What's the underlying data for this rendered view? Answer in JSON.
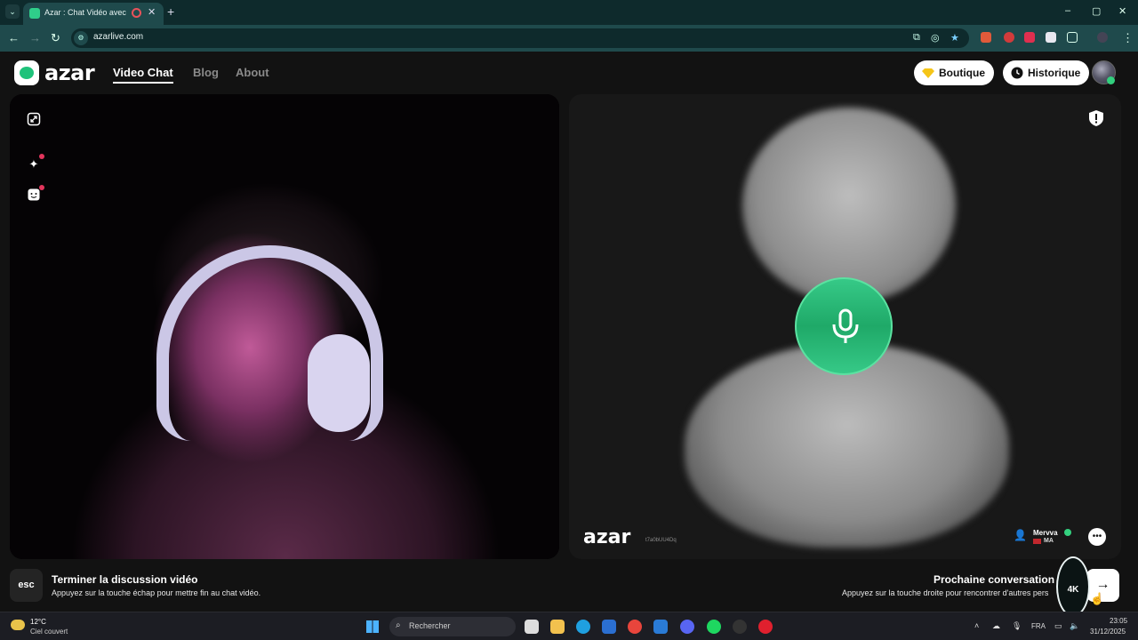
{
  "browser": {
    "tab_title": "Azar : Chat Vidéo avec de n",
    "new_tab": "+",
    "url": "azarlive.com",
    "window_controls": [
      "–",
      "▢",
      "✕"
    ]
  },
  "header": {
    "brand": "azar",
    "nav": [
      "Video Chat",
      "Blog",
      "About"
    ],
    "active_nav": "Video Chat",
    "boutique_label": "Boutique",
    "historique_label": "Historique"
  },
  "partner": {
    "watermark": "azar",
    "session_id": "t7a0bUU4Dq",
    "name": "Mervva",
    "country": "MA"
  },
  "bottom": {
    "esc_key": "esc",
    "end_title": "Terminer la discussion vidéo",
    "end_sub": "Appuyez sur la touche échap pour mettre fin au chat vidéo.",
    "next_title": "Prochaine conversation v",
    "next_sub": "Appuyez sur la touche droite pour rencontrer d'autres pers",
    "badge_text": "4K"
  },
  "taskbar": {
    "temperature": "12°C",
    "weather": "Ciel couvert",
    "search_placeholder": "Rechercher",
    "language": "FRA",
    "time": "23:05",
    "date": "31/12/2025"
  },
  "colors": {
    "accent_green": "#1fa968",
    "browser_bg": "#1f4a4c",
    "notification_red": "#e2355c"
  }
}
